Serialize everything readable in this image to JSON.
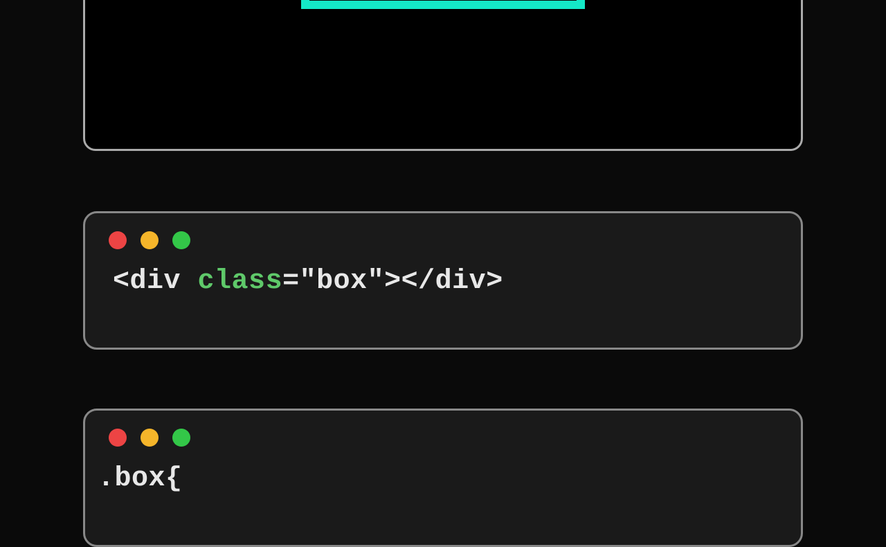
{
  "preview": {
    "box_border_color": "#14e8c7"
  },
  "traffic": {
    "red": "#ed4444",
    "yellow": "#f5b52a",
    "green": "#33c748"
  },
  "html_code": {
    "open_bracket": "<",
    "tag1": "div",
    "space": " ",
    "attr": "class",
    "eq": "=",
    "q1": "\"",
    "val": "box",
    "q2": "\"",
    "close1": ">",
    "open2": "</",
    "tag2": "div",
    "close2": ">"
  },
  "css_code": {
    "selector": ".box",
    "brace": "{"
  }
}
